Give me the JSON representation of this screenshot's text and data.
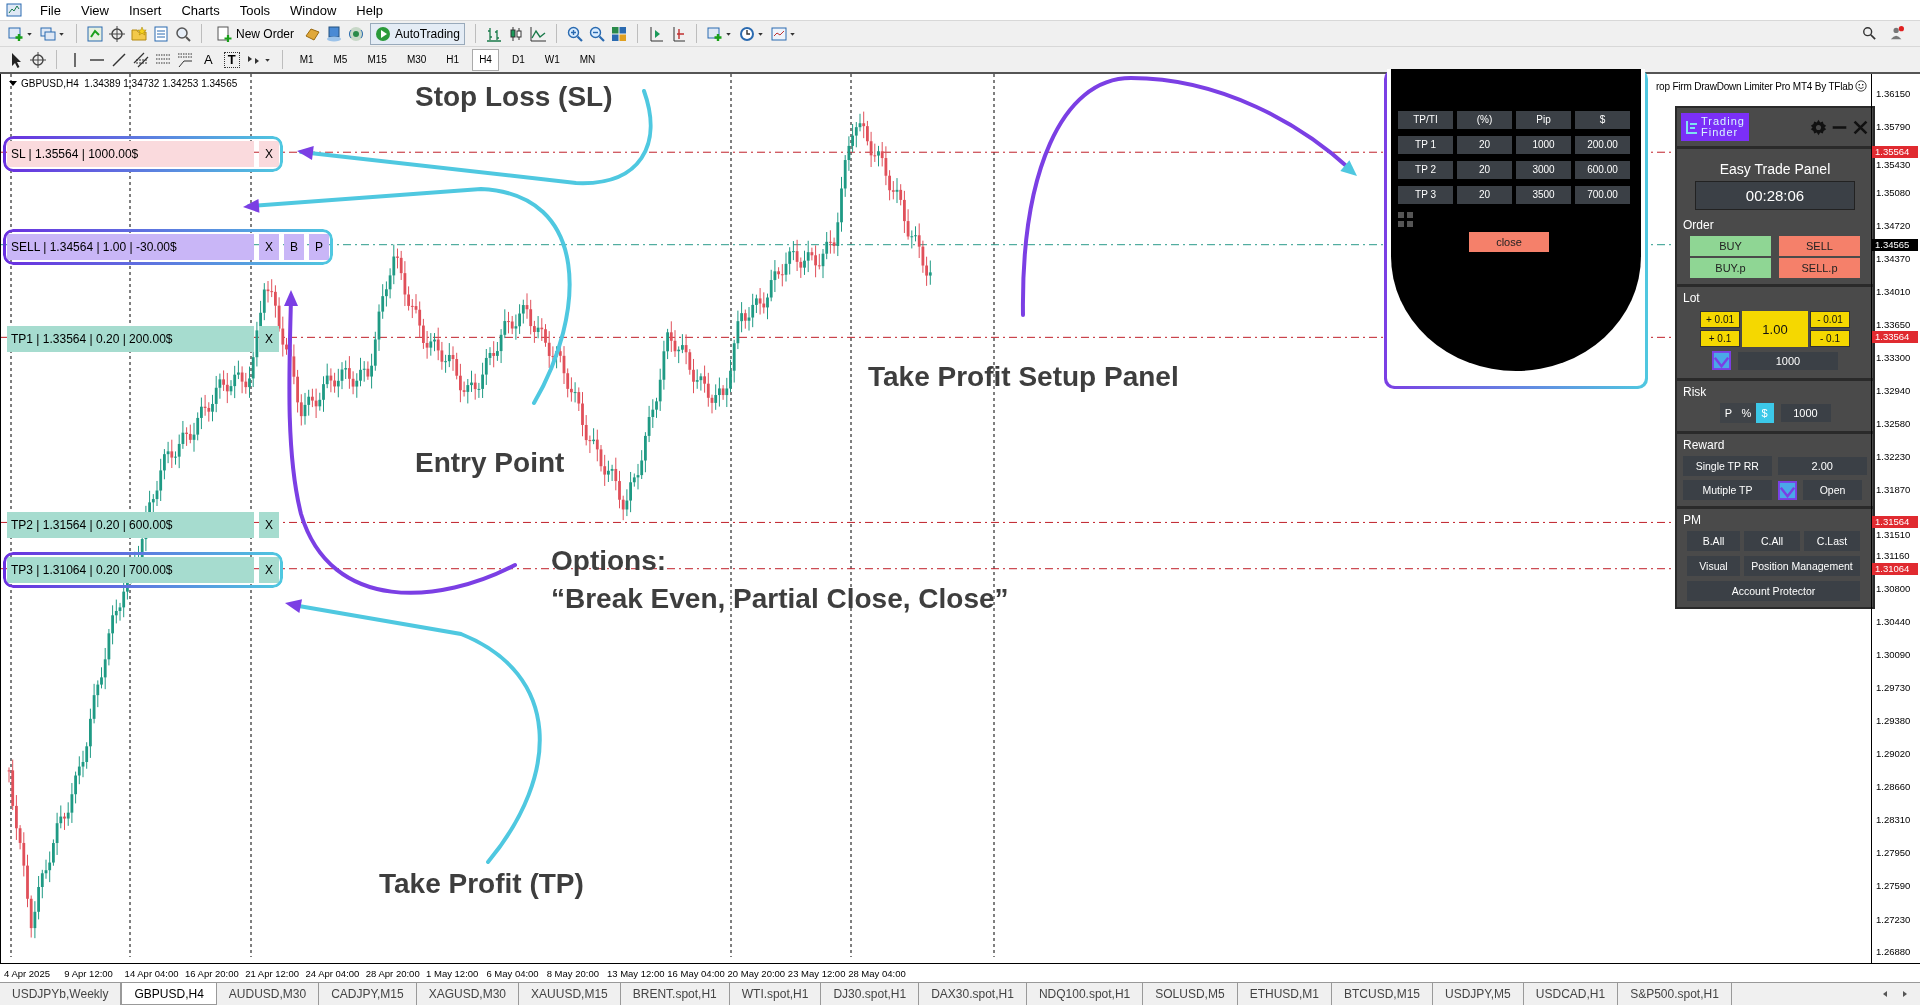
{
  "menu": [
    "File",
    "View",
    "Insert",
    "Charts",
    "Tools",
    "Window",
    "Help"
  ],
  "toolbar": {
    "new_order": "New Order",
    "autotrading": "AutoTrading",
    "text_tools": [
      "A",
      "T"
    ],
    "timeframes": [
      {
        "label": "M1",
        "selected": false
      },
      {
        "label": "M5",
        "selected": false
      },
      {
        "label": "M15",
        "selected": false
      },
      {
        "label": "M30",
        "selected": false
      },
      {
        "label": "H1",
        "selected": false
      },
      {
        "label": "H4",
        "selected": true
      },
      {
        "label": "D1",
        "selected": false
      },
      {
        "label": "W1",
        "selected": false
      },
      {
        "label": "MN",
        "selected": false
      }
    ]
  },
  "chart": {
    "symbol": "GBPUSD,H4",
    "ohlc": "1.34389 1.34732 1.34253 1.34565",
    "indicator_title": "rop Firm DrawDown Limiter Pro MT4 By TFlab",
    "trade_lines": [
      {
        "kind": "sl",
        "text": "SL | 1.35564 | 1000.00$",
        "buttons": [
          "X"
        ],
        "highlighted": true
      },
      {
        "kind": "sell",
        "text": "SELL | 1.34564 | 1.00 | -30.00$",
        "buttons": [
          "X",
          "B",
          "P"
        ],
        "highlighted": true
      },
      {
        "kind": "tp",
        "text": "TP1 | 1.33564 | 0.20 | 200.00$",
        "buttons": [
          "X"
        ],
        "highlighted": false
      },
      {
        "kind": "tp",
        "text": "TP2 | 1.31564 | 0.20 | 600.00$",
        "buttons": [
          "X"
        ],
        "highlighted": false
      },
      {
        "kind": "tp",
        "text": "TP3 | 1.31064 | 0.20 | 700.00$",
        "buttons": [
          "X"
        ],
        "highlighted": true
      }
    ],
    "annotations": [
      "Stop Loss (SL)",
      "Entry Point",
      "Take Profit Setup Panel",
      "Options:",
      "“Break Even, Partial Close, Close”",
      "Take Profit (TP)"
    ],
    "price_axis": [
      "1.36150",
      "1.35790",
      "1.35430",
      "1.35080",
      "1.34720",
      "1.34370",
      "1.34010",
      "1.33650",
      "1.33300",
      "1.32940",
      "1.32580",
      "1.32230",
      "1.31870",
      "1.31510",
      "1.31160",
      "1.30800",
      "1.30440",
      "1.30090",
      "1.29730",
      "1.29380",
      "1.29020",
      "1.28660",
      "1.28310",
      "1.27950",
      "1.27590",
      "1.27230",
      "1.26880"
    ],
    "price_markers": [
      {
        "value": "1.35564",
        "kind": "level"
      },
      {
        "value": "1.34565",
        "kind": "bid"
      },
      {
        "value": "1.33564",
        "kind": "level"
      },
      {
        "value": "1.31564",
        "kind": "level"
      },
      {
        "value": "1.31064",
        "kind": "level"
      }
    ],
    "time_axis": [
      "4 Apr 2025",
      "9 Apr 12:00",
      "14 Apr 04:00",
      "16 Apr 20:00",
      "21 Apr 12:00",
      "24 Apr 04:00",
      "28 Apr 20:00",
      "1 May 12:00",
      "6 May 04:00",
      "8 May 20:00",
      "13 May 12:00",
      "16 May 04:00",
      "20 May 20:00",
      "23 May 12:00",
      "28 May 04:00"
    ]
  },
  "tp_panel": {
    "header": [
      "TP/TI",
      "(%)",
      "Pip",
      "$"
    ],
    "rows": [
      [
        "TP 1",
        "20",
        "1000",
        "200.00"
      ],
      [
        "TP 2",
        "20",
        "3000",
        "600.00"
      ],
      [
        "TP 3",
        "20",
        "3500",
        "700.00"
      ]
    ],
    "close": "close"
  },
  "trade_panel": {
    "logo": [
      "Trading",
      "Finder"
    ],
    "title": "Easy Trade Panel",
    "timer": "00:28:06",
    "order": {
      "label": "Order",
      "buttons": [
        {
          "label": "BUY",
          "kind": "buy"
        },
        {
          "label": "SELL",
          "kind": "sell"
        },
        {
          "label": "BUY.p",
          "kind": "buy"
        },
        {
          "label": "SELL.p",
          "kind": "sell"
        }
      ]
    },
    "lot": {
      "label": "Lot",
      "plus": [
        "+ 0.01",
        "+ 0.1"
      ],
      "value": "1.00",
      "minus": [
        "- 0.01",
        "- 0.1"
      ],
      "checked": true,
      "amount": "1000"
    },
    "risk": {
      "label": "Risk",
      "modes": [
        {
          "label": "P",
          "selected": false
        },
        {
          "label": "%",
          "selected": false
        },
        {
          "label": "$",
          "selected": true
        }
      ],
      "value": "1000"
    },
    "reward": {
      "label": "Reward",
      "single_label": "Single TP RR",
      "single_value": "2.00",
      "multiple_label": "Mutiple TP",
      "multiple_checked": true,
      "open": "Open"
    },
    "pm": {
      "label": "PM",
      "buttons": [
        "B.All",
        "C.All",
        "C.Last",
        "Visual",
        "Position Management",
        "Account Protector"
      ]
    }
  },
  "tabs": [
    {
      "label": "USDJPYb,Weekly",
      "selected": false
    },
    {
      "label": "GBPUSD,H4",
      "selected": true
    },
    {
      "label": "AUDUSD,M30",
      "selected": false
    },
    {
      "label": "CADJPY,M15",
      "selected": false
    },
    {
      "label": "XAGUSD,M30",
      "selected": false
    },
    {
      "label": "XAUUSD,M15",
      "selected": false
    },
    {
      "label": "BRENT.spot,H1",
      "selected": false
    },
    {
      "label": "WTI.spot,H1",
      "selected": false
    },
    {
      "label": "DJ30.spot,H1",
      "selected": false
    },
    {
      "label": "DAX30.spot,H1",
      "selected": false
    },
    {
      "label": "NDQ100.spot,H1",
      "selected": false
    },
    {
      "label": "SOLUSD,M5",
      "selected": false
    },
    {
      "label": "ETHUSD,M1",
      "selected": false
    },
    {
      "label": "BTCUSD,M15",
      "selected": false
    },
    {
      "label": "USDJPY,M5",
      "selected": false
    },
    {
      "label": "USDCAD,H1",
      "selected": false
    },
    {
      "label": "S&P500.spot,H1",
      "selected": false
    }
  ]
}
